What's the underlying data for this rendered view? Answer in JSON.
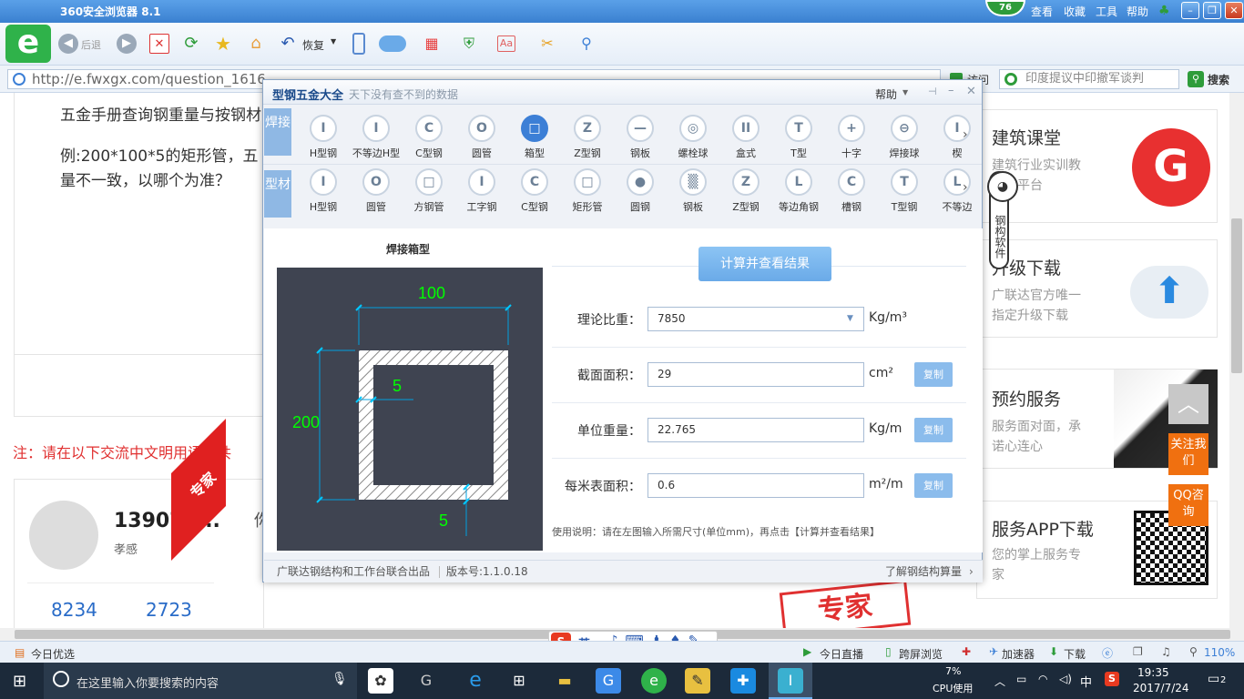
{
  "browser": {
    "title": "360安全浏览器 8.1",
    "score": "76",
    "menu": [
      "查看",
      "收藏",
      "工具",
      "帮助"
    ],
    "toolbar": {
      "back_label": "后退",
      "restore_label": "恢复"
    },
    "address": "http://e.fwxgx.com/question_1616",
    "search_placeholder": "印度提议中印撤军谈判",
    "search_label": "搜索",
    "ext_label": "访问"
  },
  "page": {
    "q_line1": "五金手册查询钢重量与按钢材",
    "q_line2": "例:200*100*5的矩形管，五",
    "q_line3": "量不一致，以哪个为准？",
    "notice": "注：请在以下交流中文明用语，共",
    "user_name": "139072...",
    "user_title": "孝感",
    "stat1": "8234",
    "stat2": "2723",
    "expert_ribbon": "专家",
    "expert_stamp": "专家",
    "reply_char": "你"
  },
  "sidebar_cards": [
    {
      "title": "建筑课堂",
      "desc1": "建筑行业实训教",
      "desc2": "育一平台"
    },
    {
      "title": "升级下载",
      "desc1": "广联达官方唯一",
      "desc2": "指定升级下载"
    },
    {
      "title": "预约服务",
      "desc1": "服务面对面，承",
      "desc2": "诺心连心"
    },
    {
      "title": "服务APP下载",
      "desc1": "您的掌上服务专",
      "desc2": "家"
    }
  ],
  "float": {
    "follow": "关注我们",
    "qq": "QQ咨询",
    "mascot": "钢构软件"
  },
  "dialog": {
    "title": "型钢五金大全",
    "subtitle": "天下没有查不到的数据",
    "help": "帮助",
    "row1_tab": "焊接",
    "row2_tab": "型材",
    "row1": [
      "H型钢",
      "不等边H型",
      "C型钢",
      "圆管",
      "箱型",
      "Z型钢",
      "钢板",
      "螺栓球",
      "盒式",
      "T型",
      "十字",
      "焊接球",
      "楔"
    ],
    "row2": [
      "H型钢",
      "圆管",
      "方钢管",
      "工字钢",
      "C型钢",
      "矩形管",
      "圆钢",
      "钢板",
      "Z型钢",
      "等边角钢",
      "槽钢",
      "T型钢",
      "不等边"
    ],
    "row1_glyphs": [
      "I",
      "I",
      "C",
      "O",
      "□",
      "Z",
      "—",
      "◎",
      "II",
      "T",
      "+",
      "⊖",
      "I"
    ],
    "row2_glyphs": [
      "I",
      "O",
      "□",
      "I",
      "C",
      "□",
      "●",
      "▒",
      "Z",
      "L",
      "C",
      "T",
      "L"
    ],
    "drawing_title": "焊接箱型",
    "dim_width": "100",
    "dim_height": "200",
    "dim_web": "5",
    "dim_flange": "5",
    "calc_button": "计算并查看结果",
    "fields": [
      {
        "label": "理论比重：",
        "value": "7850",
        "unit": "Kg/m³",
        "copy": ""
      },
      {
        "label": "截面面积：",
        "value": "29",
        "unit": "cm²",
        "copy": "复制"
      },
      {
        "label": "单位重量：",
        "value": "22.765",
        "unit": "Kg/m",
        "copy": "复制"
      },
      {
        "label": "每米表面积：",
        "value": "0.6",
        "unit": "m²/m",
        "copy": "复制"
      }
    ],
    "usage": "使用说明：请在左图输入所需尺寸(单位mm)，再点击【计算并查看结果】",
    "footer_left": "广联达钢结构和工作台联合出品",
    "footer_version": "版本号:1.1.0.18",
    "footer_right": "了解钢结构算量"
  },
  "statusbar": {
    "left": "今日优选",
    "live": "今日直播",
    "screen": "跨屏浏览",
    "accel": "加速器",
    "download": "下载",
    "zoom": "110%",
    "ime": "英"
  },
  "taskbar": {
    "search": "在这里输入你要搜索的内容",
    "cpu_pct": "7%",
    "cpu_label": "CPU使用",
    "ime": "中",
    "time": "19:35",
    "date": "2017/7/24",
    "notif": "2"
  },
  "colors": {
    "accent": "#3c7fd6",
    "drawing_line": "#00ff00",
    "ribbon": "#e02020"
  }
}
